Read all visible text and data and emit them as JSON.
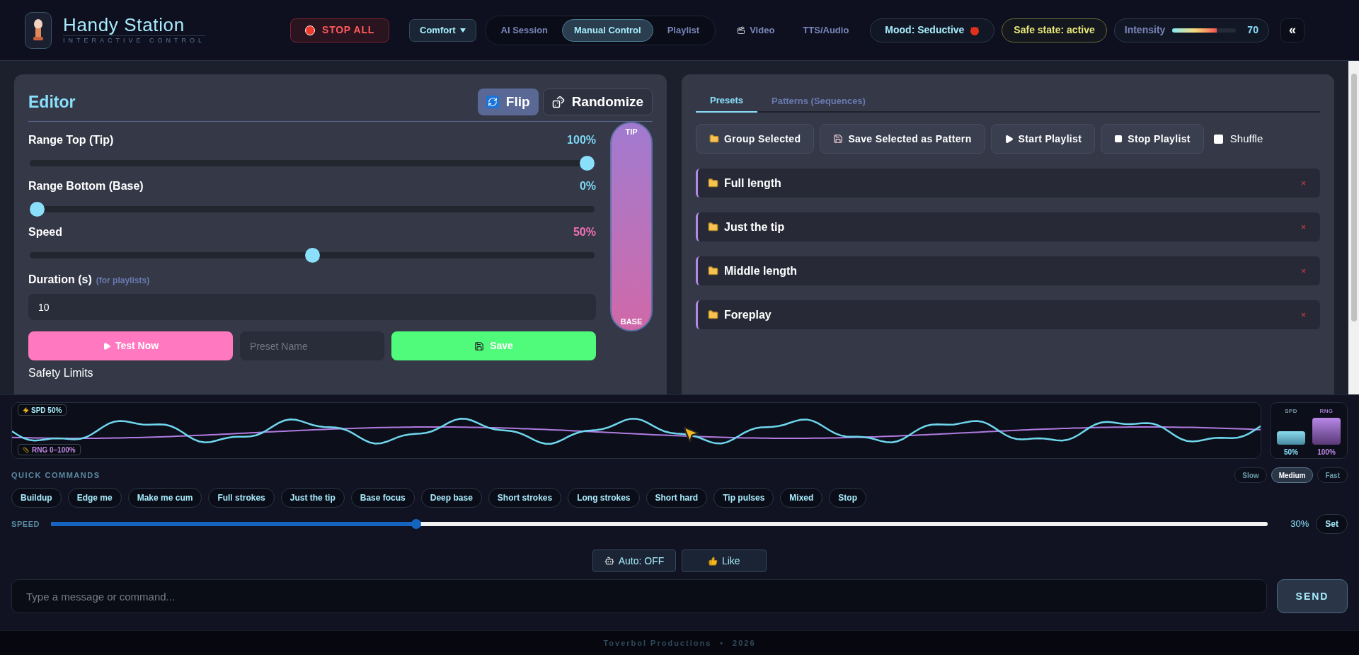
{
  "header": {
    "title": "Handy Station",
    "subtitle": "INTERACTIVE CONTROL",
    "stop_all": "STOP ALL",
    "mode": "Comfort",
    "session_tabs": [
      {
        "label": "AI Session",
        "selected": false
      },
      {
        "label": "Manual Control",
        "selected": true
      },
      {
        "label": "Playlist",
        "selected": false
      }
    ],
    "nav_tabs": [
      {
        "label": "Video",
        "kind": "video"
      },
      {
        "label": "TTS/Audio",
        "kind": "text"
      }
    ],
    "mood": "Mood: Seductive",
    "safe_state": "Safe state: active",
    "intensity": {
      "label": "Intensity",
      "level": 0.7,
      "value": "70"
    },
    "collapse": "«"
  },
  "editor": {
    "title": "Editor",
    "flip": "Flip",
    "randomize": "Randomize",
    "sliders": [
      {
        "label": "Range Top (Tip)",
        "value": "100%",
        "level": 1,
        "kind": "range"
      },
      {
        "label": "Range Bottom (Base)",
        "value": "0%",
        "level": 0,
        "kind": "range"
      },
      {
        "label": "Speed",
        "value": "50%",
        "level": 0.5,
        "kind": "speed"
      }
    ],
    "duration": {
      "label": "Duration (s)",
      "hint": "(for playlists)",
      "value": "10"
    },
    "test": "Test Now",
    "preset_placeholder": "Preset Name",
    "save": "Save",
    "safety": "Safety Limits",
    "range_bar": {
      "top": "TIP",
      "bottom": "BASE"
    }
  },
  "library": {
    "tabs": [
      {
        "label": "Presets",
        "selected": true
      },
      {
        "label": "Patterns (Sequences)",
        "selected": false
      }
    ],
    "actions": [
      {
        "label": "Group Selected",
        "kind": "folder"
      },
      {
        "label": "Save Selected as Pattern",
        "kind": "save"
      },
      {
        "label": "Start Playlist",
        "kind": "play"
      },
      {
        "label": "Stop Playlist",
        "kind": "stop"
      }
    ],
    "shuffle": {
      "label": "Shuffle",
      "checked": false
    },
    "presets": [
      {
        "name": "Full length",
        "remove": "×"
      },
      {
        "name": "Just the tip",
        "remove": "×"
      },
      {
        "name": "Middle length",
        "remove": "×"
      },
      {
        "name": "Foreplay",
        "remove": "×"
      }
    ]
  },
  "dock": {
    "spd_badge": "SPD 50%",
    "rng_badge": "RNG 0–100%",
    "meters": [
      {
        "label": "SPD",
        "value": "50%",
        "kind": "speed"
      },
      {
        "label": "RNG",
        "value": "100%",
        "kind": "range"
      }
    ],
    "quick_label": "QUICK COMMANDS",
    "tempos": [
      {
        "label": "Slow",
        "selected": false
      },
      {
        "label": "Medium",
        "selected": true
      },
      {
        "label": "Fast",
        "selected": false
      }
    ],
    "commands": [
      "Buildup",
      "Edge me",
      "Make me cum",
      "Full strokes",
      "Just the tip",
      "Base focus",
      "Deep base",
      "Short strokes",
      "Long strokes",
      "Short hard",
      "Tip pulses",
      "Mixed",
      "Stop"
    ],
    "speed": {
      "label": "SPEED",
      "level": 0.3,
      "value": "30%",
      "set": "Set"
    },
    "auto": "Auto: OFF",
    "like": "Like",
    "input_placeholder": "Type a message or command...",
    "send": "SEND"
  },
  "footer": {
    "brand": "Toverbol Productions",
    "separator": "•",
    "year": "2026"
  }
}
